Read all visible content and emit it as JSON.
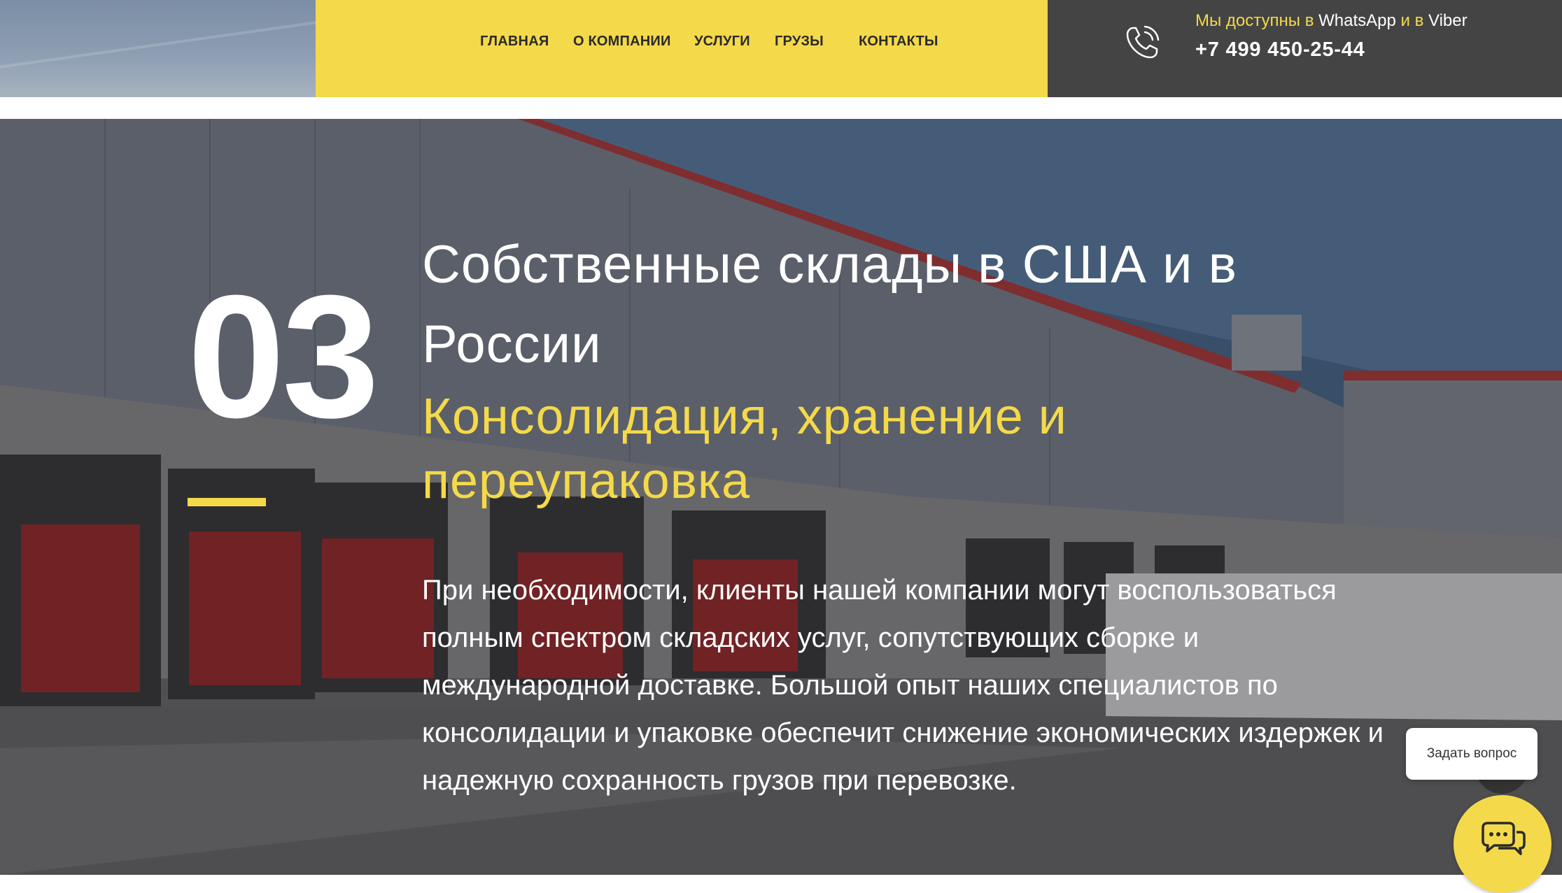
{
  "nav": {
    "items": [
      {
        "label": "ГЛАВНАЯ"
      },
      {
        "label": "О КОМПАНИИ"
      },
      {
        "label": "УСЛУГИ"
      },
      {
        "label": "ГРУЗЫ"
      },
      {
        "label": "КОНТАКТЫ"
      }
    ]
  },
  "contact": {
    "availability": {
      "part1": "Мы доступны в ",
      "whatsapp": "WhatsApp",
      "part2": " и в ",
      "viber": "Viber"
    },
    "phone": "+7 499 450-25-44",
    "icon": "phone-icon"
  },
  "hero": {
    "number": "03",
    "title": "Собственные склады в США и в России",
    "subtitle": "Консолидация, хранение и переупаковка",
    "text": "При необходимости, клиенты нашей компании могут воспользоваться полным спектром складских услуг, сопутствующих сборке и международной доставке. Большой опыт наших специалистов по консолидации и упаковке обеспечит снижение экономических издержек и надежную сохранность грузов при перевозке."
  },
  "chat": {
    "ask_label": "Задать вопрос",
    "icon": "chat-icon"
  },
  "colors": {
    "accent": "#f4d94a",
    "dark": "#444444",
    "text_dark": "#2b2b2b"
  }
}
